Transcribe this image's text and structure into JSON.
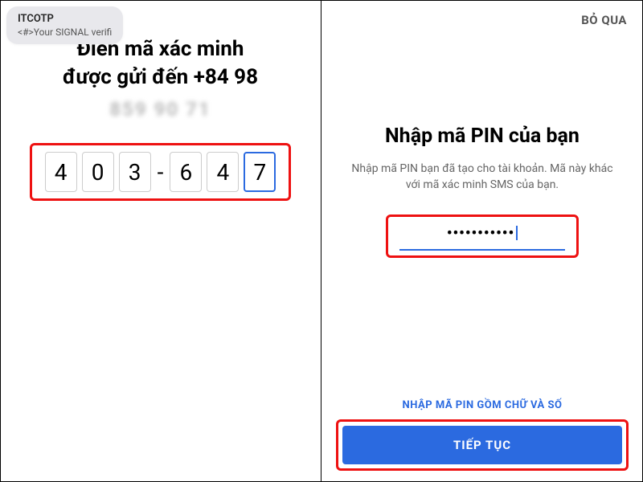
{
  "notification": {
    "title": "ITCOTP",
    "body": "<#>Your SIGNAL verifi"
  },
  "left": {
    "heading_line1": "Điền mã xác minh",
    "heading_line2": "được gửi đến +84 98",
    "blurred_digits": "859 90 71",
    "otp": [
      "4",
      "0",
      "3",
      "6",
      "4",
      "7"
    ],
    "separator": "-"
  },
  "right": {
    "skip_label": "BỎ QUA",
    "heading": "Nhập mã PIN của bạn",
    "subtext": "Nhập mã PIN bạn đã tạo cho tài khoản. Mã này khác với mã xác minh SMS của bạn.",
    "pin_mask": "•••••••••••",
    "alpha_link": "NHẬP MÃ PIN GỒM CHỮ VÀ SỐ",
    "continue_label": "TIẾP TỤC"
  },
  "colors": {
    "accent": "#2b6ae0",
    "highlight_border": "#e11"
  }
}
